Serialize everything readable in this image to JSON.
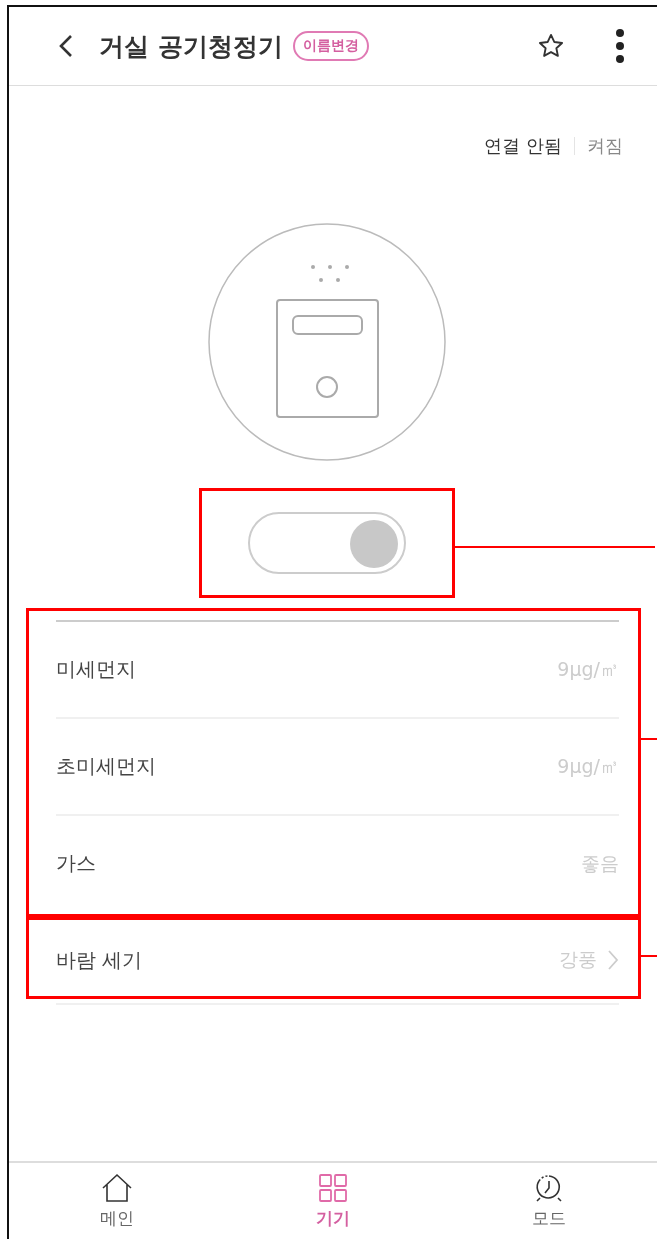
{
  "header": {
    "title": "거실 공기청정기",
    "rename_badge": "이름변경",
    "favorite": false
  },
  "status": {
    "connection": "연결 안됨",
    "power": "켜짐"
  },
  "power_toggle": {
    "on": true,
    "disabled": true,
    "highlighted": true
  },
  "readings_highlighted": true,
  "readings": [
    {
      "label": "미세먼지",
      "value": "9μg/㎥"
    },
    {
      "label": "초미세먼지",
      "value": "9μg/㎥"
    },
    {
      "label": "가스",
      "value": "좋음"
    }
  ],
  "wind": {
    "label": "바람 세기",
    "value": "강풍",
    "highlighted": true
  },
  "nav": [
    {
      "label": "메인",
      "selected": false
    },
    {
      "label": "기기",
      "selected": true
    },
    {
      "label": "모드",
      "selected": false
    }
  ]
}
